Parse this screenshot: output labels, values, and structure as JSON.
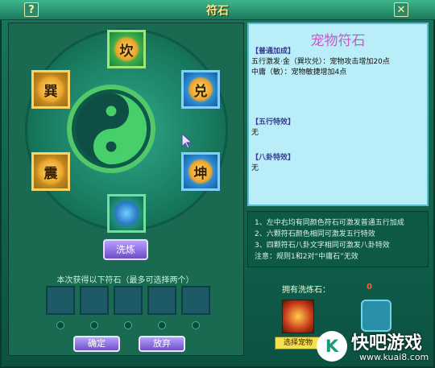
{
  "window": {
    "title": "符石",
    "help_label": "?",
    "close_label": "✕"
  },
  "board": {
    "stones": [
      {
        "name": "kan",
        "char": "坎"
      },
      {
        "name": "dui",
        "char": "兑"
      },
      {
        "name": "kun",
        "char": "坤"
      },
      {
        "name": "bottom",
        "char": ""
      },
      {
        "name": "zhen",
        "char": "震"
      },
      {
        "name": "xun",
        "char": "巽"
      }
    ]
  },
  "controls": {
    "wash_label": "洗炼",
    "obtain_text": "本次获得以下符石（最多可选择两个）",
    "confirm_label": "确定",
    "abandon_label": "放弃"
  },
  "info": {
    "title": "宠物符石",
    "general_heading": "【普通加成】",
    "general_line1": "五行激发·金（巽坎兑）：宠物攻击增加20点",
    "general_line2": "中庸（敏）：宠物敏捷增加4点",
    "wuxing_heading": "【五行特效】",
    "wuxing_value": "无",
    "bagua_heading": "【八卦特效】",
    "bagua_value": "无"
  },
  "rules": {
    "line1": "1、左中右均有同颜色符石可激发普通五行加成",
    "line2": "2、六颗符石颜色相同可激发五行特效",
    "line3": "3、四颗符石八卦文字相同可激发八卦特效",
    "line4": "注意：规则1和2对“中庸石”无效"
  },
  "wash_stone": {
    "label": "拥有洗炼石：",
    "count": "0"
  },
  "pet": {
    "select_label": "选择宠物"
  },
  "watermark": {
    "name": "快吧游戏",
    "url": "www.kuai8.com",
    "icon": "K"
  }
}
